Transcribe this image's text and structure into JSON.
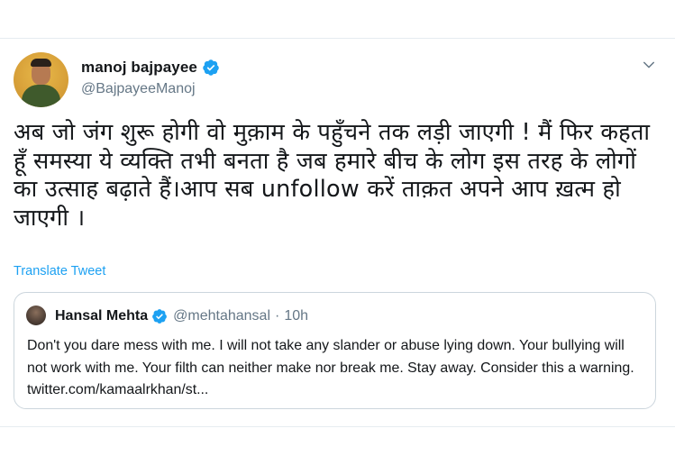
{
  "tweet": {
    "display_name": "manoj bajpayee",
    "handle": "@BajpayeeManoj",
    "text": "अब जो जंग शुरू होगी वो मुक़ाम के पहुँचने तक लड़ी जाएगी ! मैं फिर कहता हूँ समस्या ये व्यक्ति तभी बनता है जब हमारे बीच के लोग इस तरह के लोगों का उत्साह बढ़ाते हैं।आप सब unfollow करें ताक़त अपने आप ख़त्म हो जाएगी ।",
    "translate_label": "Translate Tweet",
    "verified_icon": "verified-badge-icon",
    "menu_icon": "chevron-down-icon"
  },
  "quoted_tweet": {
    "display_name": "Hansal Mehta",
    "handle": "@mehtahansal",
    "separator": "·",
    "time": "10h",
    "text": "Don't you dare mess with me. I will not take any slander or abuse lying down. Your bullying will not work with me. Your filth can neither make nor break me.  Stay away. Consider this a warning. twitter.com/kamaalrkhan/st..."
  },
  "colors": {
    "accent": "#1da1f2",
    "text_primary": "#14171a",
    "text_secondary": "#657786",
    "border": "#ccd6dd",
    "avatar_background": "#d9a23a"
  }
}
